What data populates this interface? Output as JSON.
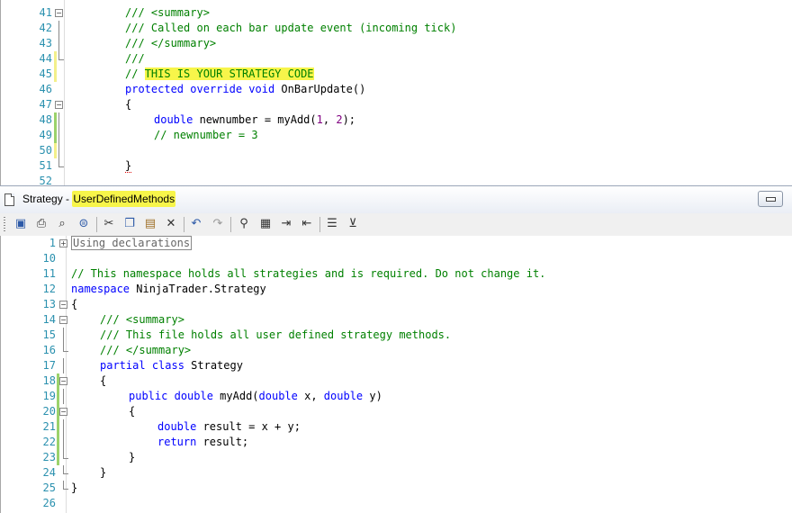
{
  "window": {
    "title_prefix": "Strategy - ",
    "title_name": "UserDefinedMethods"
  },
  "top_editor": {
    "lines": [
      {
        "n": "41",
        "parts": [
          "/// <summary>"
        ]
      },
      {
        "n": "42",
        "parts": [
          "/// Called on each bar update event (incoming tick)"
        ]
      },
      {
        "n": "43",
        "parts": [
          "/// </summary>"
        ]
      },
      {
        "n": "44",
        "parts": [
          "///"
        ]
      },
      {
        "n": "45",
        "parts": [
          "// ",
          "THIS IS YOUR STRATEGY CODE"
        ]
      },
      {
        "n": "46",
        "parts": [
          "protected",
          " ",
          "override",
          " ",
          "void",
          " OnBarUpdate()"
        ]
      },
      {
        "n": "47",
        "parts": [
          "{"
        ]
      },
      {
        "n": "48",
        "parts": [
          "double",
          " newnumber = myAdd(",
          "1",
          ", ",
          "2",
          ");"
        ]
      },
      {
        "n": "49",
        "parts": [
          "// newnumber = 3"
        ]
      },
      {
        "n": "50",
        "parts": [
          ""
        ]
      },
      {
        "n": "51",
        "parts": [
          "}"
        ]
      },
      {
        "n": "52",
        "parts": [
          ""
        ]
      }
    ]
  },
  "bottom_editor": {
    "lines": [
      {
        "n": "1",
        "parts": [
          "Using declarations"
        ]
      },
      {
        "n": "10",
        "parts": [
          ""
        ]
      },
      {
        "n": "11",
        "parts": [
          "// This namespace holds all strategies and is required. Do not change it."
        ]
      },
      {
        "n": "12",
        "parts": [
          "namespace",
          " NinjaTrader.Strategy"
        ]
      },
      {
        "n": "13",
        "parts": [
          "{"
        ]
      },
      {
        "n": "14",
        "parts": [
          "/// <summary>"
        ]
      },
      {
        "n": "15",
        "parts": [
          "/// This file holds all user defined strategy methods."
        ]
      },
      {
        "n": "16",
        "parts": [
          "/// </summary>"
        ]
      },
      {
        "n": "17",
        "parts": [
          "partial",
          " ",
          "class",
          " Strategy"
        ]
      },
      {
        "n": "18",
        "parts": [
          "{"
        ]
      },
      {
        "n": "19",
        "parts": [
          "public",
          " ",
          "double",
          " myAdd(",
          "double",
          " x, ",
          "double",
          " y)"
        ]
      },
      {
        "n": "20",
        "parts": [
          "{"
        ]
      },
      {
        "n": "21",
        "parts": [
          "double",
          " result = x + y;"
        ]
      },
      {
        "n": "22",
        "parts": [
          "return",
          " result;"
        ]
      },
      {
        "n": "23",
        "parts": [
          "}"
        ]
      },
      {
        "n": "24",
        "parts": [
          "}"
        ]
      },
      {
        "n": "25",
        "parts": [
          "}"
        ]
      },
      {
        "n": "26",
        "parts": [
          ""
        ]
      }
    ]
  },
  "toolbar": {
    "icons": [
      "save-icon",
      "print-icon",
      "print-preview-icon",
      "properties-icon",
      "cut-icon",
      "copy-icon",
      "paste-icon",
      "delete-icon",
      "undo-icon",
      "redo-icon",
      "find-icon",
      "replace-icon",
      "indent-icon",
      "outdent-icon",
      "comment-icon",
      "uncomment-icon"
    ]
  }
}
